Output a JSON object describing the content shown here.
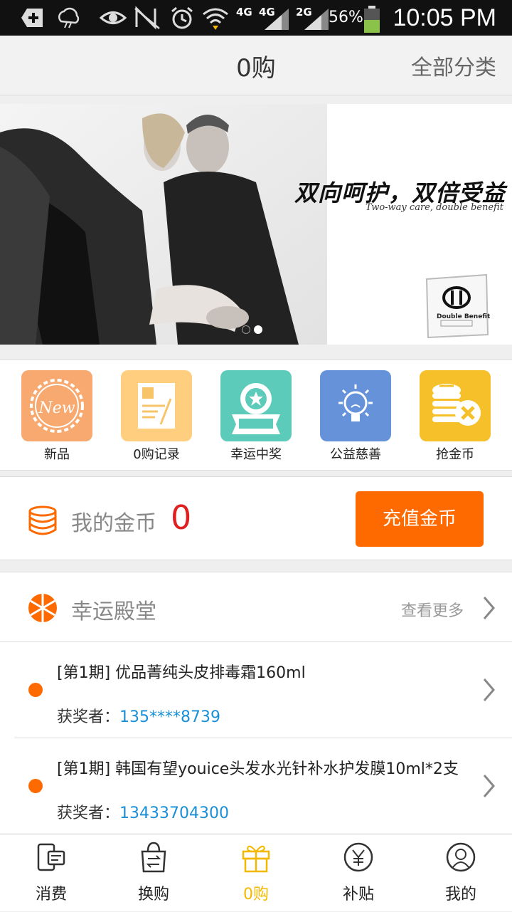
{
  "status_bar": {
    "time": "10:05 PM",
    "battery_percent": "56%",
    "net_1": "4G",
    "net_2": "4G",
    "net_3": "2G",
    "icons": [
      "add-icon",
      "weather-icon",
      "eye-icon",
      "no-signal-icon",
      "alarm-icon",
      "wifi-icon",
      "signal-icon",
      "battery-icon"
    ]
  },
  "header": {
    "title": "0购",
    "all_categories": "全部分类"
  },
  "banner": {
    "slogan": "双向呵护，双倍受益",
    "subtitle": "Two-way care, double benefit",
    "brand": "Double Benefit",
    "slide_count": 2,
    "active_slide": 2
  },
  "categories": [
    {
      "label": "新品",
      "icon": "new-badge-icon",
      "color": "#f7a96f"
    },
    {
      "label": "0购记录",
      "icon": "document-icon",
      "color": "#ffcf7f"
    },
    {
      "label": "幸运中奖",
      "icon": "award-icon",
      "color": "#5ccbb9"
    },
    {
      "label": "公益慈善",
      "icon": "lightbulb-icon",
      "color": "#6592d8"
    },
    {
      "label": "抢金币",
      "icon": "coins-icon",
      "color": "#f6c02a"
    }
  ],
  "coins": {
    "label": "我的金币",
    "count": "0",
    "recharge_button": "充值金币",
    "accent": "#ff6a00"
  },
  "lucky_hall": {
    "title": "幸运殿堂",
    "more": "查看更多",
    "items": [
      {
        "name": "[第1期] 优品菁纯头皮排毒霜160ml",
        "winner_label": "获奖者：",
        "winner": "135****8739"
      },
      {
        "name": "[第1期] 韩国有望youice头发水光针补水护发膜10ml*2支",
        "winner_label": "获奖者：",
        "winner": "13433704300"
      }
    ]
  },
  "bottom_nav": [
    {
      "label": "消费",
      "icon": "phone-card-icon",
      "active": false
    },
    {
      "label": "换购",
      "icon": "shopping-bag-icon",
      "active": false
    },
    {
      "label": "0购",
      "icon": "gift-icon",
      "active": true
    },
    {
      "label": "补贴",
      "icon": "yen-icon",
      "active": false
    },
    {
      "label": "我的",
      "icon": "user-icon",
      "active": false
    }
  ]
}
